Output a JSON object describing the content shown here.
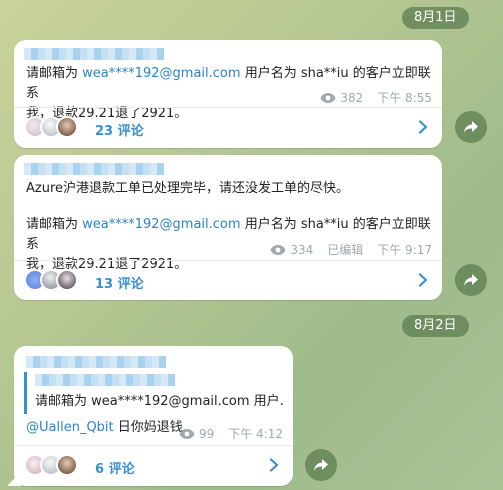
{
  "dates": [
    "8月1日",
    "8月2日"
  ],
  "messages": [
    {
      "text_before": "请邮箱为 ",
      "email": "wea****192@gmail.com",
      "text_after": " 用户名为 sha**iu 的客户立即联系",
      "text_line2": "我，退款29.21退了2921。",
      "views": "382",
      "time": "下午 8:55",
      "comments": "23 评论"
    },
    {
      "intro": "Azure沪港退款工单已处理完毕，请还没发工单的尽快。",
      "text_before": "请邮箱为 ",
      "email": "wea****192@gmail.com",
      "text_after": " 用户名为 sha**iu 的客户立即联系",
      "text_line2": "我，退款29.21退了2921。",
      "views": "334",
      "edited": "已编辑",
      "time": "下午 9:17",
      "comments": "13 评论"
    },
    {
      "quote": "请邮箱为 wea****192@gmail.com 用户…",
      "mention": "@Uallen_Qbit",
      "reply_text": " 日你妈退钱",
      "views": "99",
      "time": "下午 4:12",
      "comments": "6 评论"
    }
  ],
  "colors": {
    "link": "#2a83c6",
    "comment": "#3a8fd0",
    "date_pill": "#608052"
  }
}
